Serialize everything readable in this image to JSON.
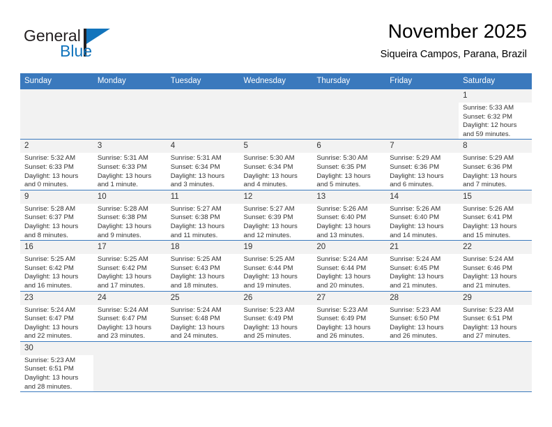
{
  "brand": {
    "name_part1": "General",
    "name_part2": "Blue",
    "accent_color": "#1274bc"
  },
  "header": {
    "title": "November 2025",
    "location": "Siqueira Campos, Parana, Brazil"
  },
  "calendar": {
    "header_color": "#3a79bd",
    "weekdays": [
      "Sunday",
      "Monday",
      "Tuesday",
      "Wednesday",
      "Thursday",
      "Friday",
      "Saturday"
    ],
    "weeks": [
      [
        {
          "day": ""
        },
        {
          "day": ""
        },
        {
          "day": ""
        },
        {
          "day": ""
        },
        {
          "day": ""
        },
        {
          "day": ""
        },
        {
          "day": "1",
          "sunrise": "Sunrise: 5:33 AM",
          "sunset": "Sunset: 6:32 PM",
          "daylight_line1": "Daylight: 12 hours",
          "daylight_line2": "and 59 minutes."
        }
      ],
      [
        {
          "day": "2",
          "sunrise": "Sunrise: 5:32 AM",
          "sunset": "Sunset: 6:33 PM",
          "daylight_line1": "Daylight: 13 hours",
          "daylight_line2": "and 0 minutes."
        },
        {
          "day": "3",
          "sunrise": "Sunrise: 5:31 AM",
          "sunset": "Sunset: 6:33 PM",
          "daylight_line1": "Daylight: 13 hours",
          "daylight_line2": "and 1 minute."
        },
        {
          "day": "4",
          "sunrise": "Sunrise: 5:31 AM",
          "sunset": "Sunset: 6:34 PM",
          "daylight_line1": "Daylight: 13 hours",
          "daylight_line2": "and 3 minutes."
        },
        {
          "day": "5",
          "sunrise": "Sunrise: 5:30 AM",
          "sunset": "Sunset: 6:34 PM",
          "daylight_line1": "Daylight: 13 hours",
          "daylight_line2": "and 4 minutes."
        },
        {
          "day": "6",
          "sunrise": "Sunrise: 5:30 AM",
          "sunset": "Sunset: 6:35 PM",
          "daylight_line1": "Daylight: 13 hours",
          "daylight_line2": "and 5 minutes."
        },
        {
          "day": "7",
          "sunrise": "Sunrise: 5:29 AM",
          "sunset": "Sunset: 6:36 PM",
          "daylight_line1": "Daylight: 13 hours",
          "daylight_line2": "and 6 minutes."
        },
        {
          "day": "8",
          "sunrise": "Sunrise: 5:29 AM",
          "sunset": "Sunset: 6:36 PM",
          "daylight_line1": "Daylight: 13 hours",
          "daylight_line2": "and 7 minutes."
        }
      ],
      [
        {
          "day": "9",
          "sunrise": "Sunrise: 5:28 AM",
          "sunset": "Sunset: 6:37 PM",
          "daylight_line1": "Daylight: 13 hours",
          "daylight_line2": "and 8 minutes."
        },
        {
          "day": "10",
          "sunrise": "Sunrise: 5:28 AM",
          "sunset": "Sunset: 6:38 PM",
          "daylight_line1": "Daylight: 13 hours",
          "daylight_line2": "and 9 minutes."
        },
        {
          "day": "11",
          "sunrise": "Sunrise: 5:27 AM",
          "sunset": "Sunset: 6:38 PM",
          "daylight_line1": "Daylight: 13 hours",
          "daylight_line2": "and 11 minutes."
        },
        {
          "day": "12",
          "sunrise": "Sunrise: 5:27 AM",
          "sunset": "Sunset: 6:39 PM",
          "daylight_line1": "Daylight: 13 hours",
          "daylight_line2": "and 12 minutes."
        },
        {
          "day": "13",
          "sunrise": "Sunrise: 5:26 AM",
          "sunset": "Sunset: 6:40 PM",
          "daylight_line1": "Daylight: 13 hours",
          "daylight_line2": "and 13 minutes."
        },
        {
          "day": "14",
          "sunrise": "Sunrise: 5:26 AM",
          "sunset": "Sunset: 6:40 PM",
          "daylight_line1": "Daylight: 13 hours",
          "daylight_line2": "and 14 minutes."
        },
        {
          "day": "15",
          "sunrise": "Sunrise: 5:26 AM",
          "sunset": "Sunset: 6:41 PM",
          "daylight_line1": "Daylight: 13 hours",
          "daylight_line2": "and 15 minutes."
        }
      ],
      [
        {
          "day": "16",
          "sunrise": "Sunrise: 5:25 AM",
          "sunset": "Sunset: 6:42 PM",
          "daylight_line1": "Daylight: 13 hours",
          "daylight_line2": "and 16 minutes."
        },
        {
          "day": "17",
          "sunrise": "Sunrise: 5:25 AM",
          "sunset": "Sunset: 6:42 PM",
          "daylight_line1": "Daylight: 13 hours",
          "daylight_line2": "and 17 minutes."
        },
        {
          "day": "18",
          "sunrise": "Sunrise: 5:25 AM",
          "sunset": "Sunset: 6:43 PM",
          "daylight_line1": "Daylight: 13 hours",
          "daylight_line2": "and 18 minutes."
        },
        {
          "day": "19",
          "sunrise": "Sunrise: 5:25 AM",
          "sunset": "Sunset: 6:44 PM",
          "daylight_line1": "Daylight: 13 hours",
          "daylight_line2": "and 19 minutes."
        },
        {
          "day": "20",
          "sunrise": "Sunrise: 5:24 AM",
          "sunset": "Sunset: 6:44 PM",
          "daylight_line1": "Daylight: 13 hours",
          "daylight_line2": "and 20 minutes."
        },
        {
          "day": "21",
          "sunrise": "Sunrise: 5:24 AM",
          "sunset": "Sunset: 6:45 PM",
          "daylight_line1": "Daylight: 13 hours",
          "daylight_line2": "and 21 minutes."
        },
        {
          "day": "22",
          "sunrise": "Sunrise: 5:24 AM",
          "sunset": "Sunset: 6:46 PM",
          "daylight_line1": "Daylight: 13 hours",
          "daylight_line2": "and 21 minutes."
        }
      ],
      [
        {
          "day": "23",
          "sunrise": "Sunrise: 5:24 AM",
          "sunset": "Sunset: 6:47 PM",
          "daylight_line1": "Daylight: 13 hours",
          "daylight_line2": "and 22 minutes."
        },
        {
          "day": "24",
          "sunrise": "Sunrise: 5:24 AM",
          "sunset": "Sunset: 6:47 PM",
          "daylight_line1": "Daylight: 13 hours",
          "daylight_line2": "and 23 minutes."
        },
        {
          "day": "25",
          "sunrise": "Sunrise: 5:24 AM",
          "sunset": "Sunset: 6:48 PM",
          "daylight_line1": "Daylight: 13 hours",
          "daylight_line2": "and 24 minutes."
        },
        {
          "day": "26",
          "sunrise": "Sunrise: 5:23 AM",
          "sunset": "Sunset: 6:49 PM",
          "daylight_line1": "Daylight: 13 hours",
          "daylight_line2": "and 25 minutes."
        },
        {
          "day": "27",
          "sunrise": "Sunrise: 5:23 AM",
          "sunset": "Sunset: 6:49 PM",
          "daylight_line1": "Daylight: 13 hours",
          "daylight_line2": "and 26 minutes."
        },
        {
          "day": "28",
          "sunrise": "Sunrise: 5:23 AM",
          "sunset": "Sunset: 6:50 PM",
          "daylight_line1": "Daylight: 13 hours",
          "daylight_line2": "and 26 minutes."
        },
        {
          "day": "29",
          "sunrise": "Sunrise: 5:23 AM",
          "sunset": "Sunset: 6:51 PM",
          "daylight_line1": "Daylight: 13 hours",
          "daylight_line2": "and 27 minutes."
        }
      ],
      [
        {
          "day": "30",
          "sunrise": "Sunrise: 5:23 AM",
          "sunset": "Sunset: 6:51 PM",
          "daylight_line1": "Daylight: 13 hours",
          "daylight_line2": "and 28 minutes."
        },
        {
          "day": ""
        },
        {
          "day": ""
        },
        {
          "day": ""
        },
        {
          "day": ""
        },
        {
          "day": ""
        },
        {
          "day": ""
        }
      ]
    ]
  }
}
